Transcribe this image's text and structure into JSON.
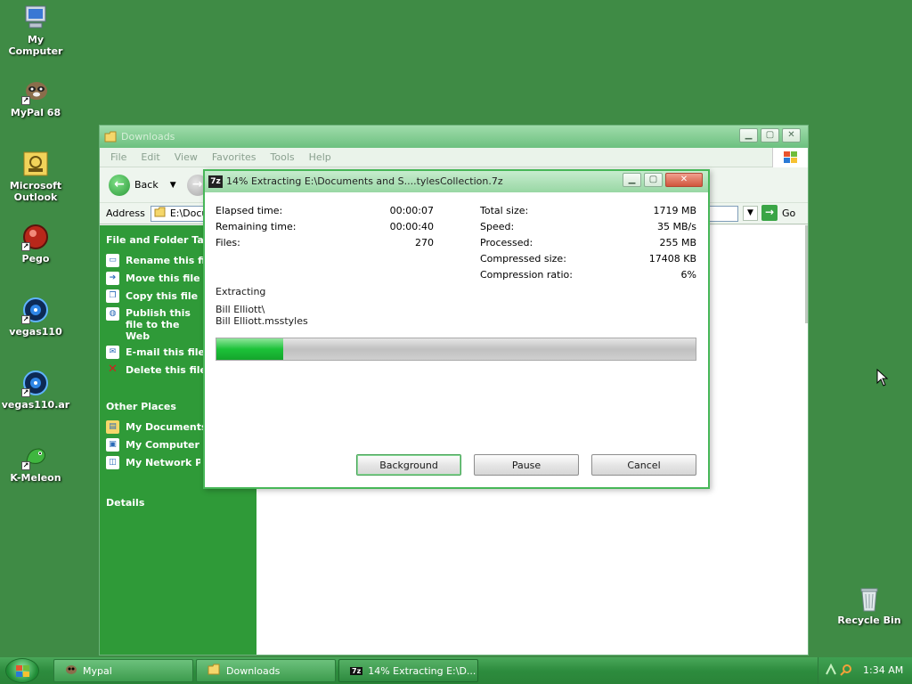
{
  "desktop": {
    "icons": [
      {
        "label": "My Computer",
        "icon": "computer-icon"
      },
      {
        "label": "MyPal 68",
        "icon": "mypal-icon"
      },
      {
        "label": "Microsoft Outlook",
        "icon": "outlook-icon"
      },
      {
        "label": "Pego",
        "icon": "pego-icon"
      },
      {
        "label": "vegas110",
        "icon": "vegas-icon"
      },
      {
        "label": "vegas110.ar",
        "icon": "vegas-icon"
      },
      {
        "label": "K-Meleon",
        "icon": "kmeleon-icon"
      },
      {
        "label": "Recycle Bin",
        "icon": "recycle-bin-icon"
      }
    ]
  },
  "explorer": {
    "title": "Downloads",
    "menu": [
      "File",
      "Edit",
      "View",
      "Favorites",
      "Tools",
      "Help"
    ],
    "back_label": "Back",
    "address_label": "Address",
    "address_value": "E:\\Docu",
    "go_label": "Go",
    "tasks": {
      "heading": "File and Folder Tasks",
      "items": [
        {
          "label": "Rename this file",
          "icon": "rename-icon"
        },
        {
          "label": "Move this file",
          "icon": "move-icon"
        },
        {
          "label": "Copy this file",
          "icon": "copy-icon"
        },
        {
          "label": "Publish this file to the Web",
          "icon": "publish-icon"
        },
        {
          "label": "E-mail this file",
          "icon": "email-icon"
        },
        {
          "label": "Delete this file",
          "icon": "delete-icon"
        }
      ]
    },
    "other_places": {
      "heading": "Other Places",
      "items": [
        {
          "label": "My Documents",
          "icon": "documents-icon"
        },
        {
          "label": "My Computer",
          "icon": "computer-icon"
        },
        {
          "label": "My Network Places",
          "icon": "network-icon"
        }
      ]
    },
    "details_heading": "Details"
  },
  "dialog": {
    "title": "14% Extracting E:\\Documents and S....tylesCollection.7z",
    "icon_text": "7z",
    "left_stats": [
      {
        "label": "Elapsed time:",
        "value": "00:00:07"
      },
      {
        "label": "Remaining time:",
        "value": "00:00:40"
      },
      {
        "label": "Files:",
        "value": "270"
      }
    ],
    "right_stats": [
      {
        "label": "Total size:",
        "value": "1719 MB"
      },
      {
        "label": "Speed:",
        "value": "35 MB/s"
      },
      {
        "label": "Processed:",
        "value": "255 MB"
      },
      {
        "label": "Compressed size:",
        "value": "17408 KB"
      },
      {
        "label": "Compression ratio:",
        "value": "6%"
      }
    ],
    "status": "Extracting",
    "path_line1": "Bill Elliott\\",
    "path_line2": "Bill Elliott.msstyles",
    "progress": 0.14,
    "buttons": {
      "background": "Background",
      "pause": "Pause",
      "cancel": "Cancel"
    }
  },
  "taskbar": {
    "items": [
      {
        "label": "Mypal",
        "icon": "mypal-icon"
      },
      {
        "label": "Downloads",
        "icon": "folder-icon"
      },
      {
        "label": "14% Extracting E:\\D...",
        "icon": "7z-icon"
      }
    ],
    "clock": "1:34 AM"
  },
  "colors": {
    "desktop": "#3f8b45",
    "task_pane": "#2f9a38",
    "progress": "#1cc239",
    "dialog_border": "#47b758"
  }
}
